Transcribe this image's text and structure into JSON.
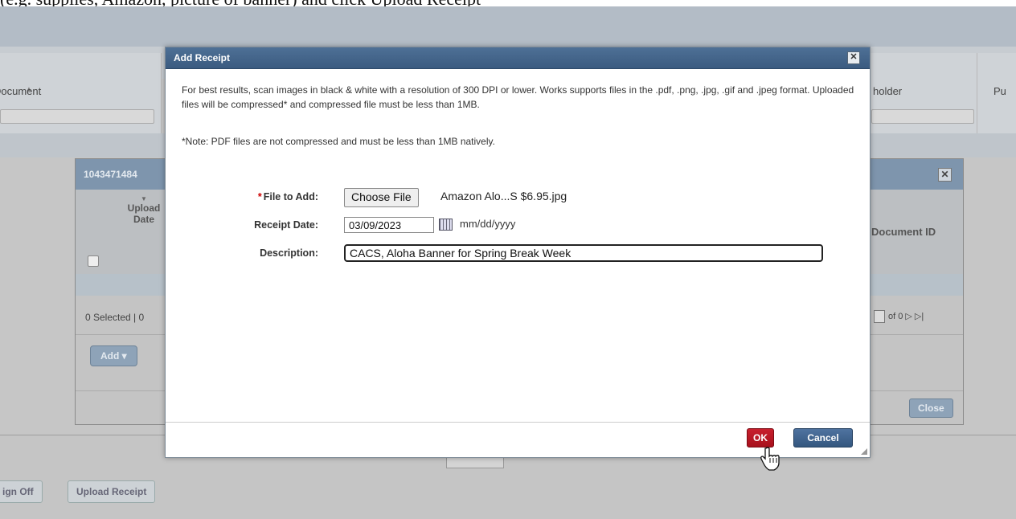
{
  "caption_cropped": "(e.g. supplies, Amazon, picture of banner) and click Upload Receipt",
  "background": {
    "col_document": "Document",
    "col_cardholder": "holder",
    "col_purchase_partial": "Pu",
    "buttons": {
      "sign_off": "ign Off",
      "upload_receipt": "Upload Receipt"
    }
  },
  "mid_popup": {
    "title": "1043471484",
    "col_upload_date": "Upload Date",
    "col_document_id": "Document ID",
    "selected_text": "0 Selected | 0",
    "pager_text": "of 0 ▷ ▷|",
    "add_label": "Add ▾",
    "close_label": "Close",
    "close_icon": "✕"
  },
  "dialog": {
    "title": "Add Receipt",
    "close_icon": "✕",
    "info": "For best results, scan images in black & white with a resolution of 300 DPI or lower. Works supports files in the .pdf, .png, .jpg, .gif and .jpeg format. Uploaded files will be compressed* and compressed file must be less than 1MB.",
    "note": "*Note: PDF files are not compressed and must be less than 1MB natively.",
    "file_label": "File to Add:",
    "required_marker": "*",
    "choose_file_label": "Choose File",
    "file_name": "Amazon Alo...S $6.95.jpg",
    "receipt_date_label": "Receipt Date:",
    "receipt_date_value": "03/09/2023",
    "date_format_hint": "mm/dd/yyyy",
    "description_label": "Description:",
    "description_value": "CACS, Aloha Banner for Spring Break Week",
    "ok_label": "OK",
    "cancel_label": "Cancel"
  },
  "colors": {
    "title_bar": "#3b5b80",
    "ok_button": "#b0141f",
    "cancel_button": "#3d5f88",
    "required": "#cc0000"
  },
  "icons": [
    "close-icon",
    "calendar-icon",
    "hand-cursor-icon",
    "sort-arrow-icon",
    "dropdown-arrow-icon"
  ]
}
